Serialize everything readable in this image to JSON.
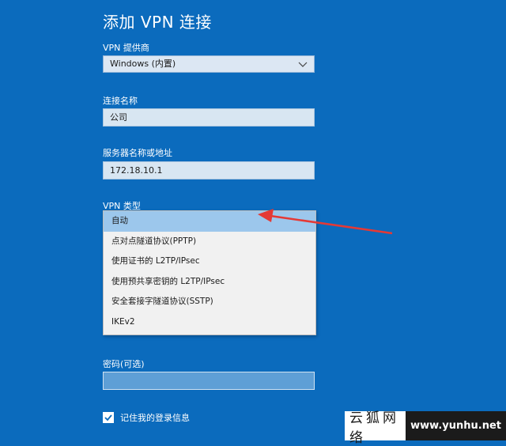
{
  "page": {
    "title": "添加 VPN 连接"
  },
  "provider": {
    "label": "VPN 提供商",
    "value": "Windows (内置)"
  },
  "connection_name": {
    "label": "连接名称",
    "value": "公司"
  },
  "server": {
    "label": "服务器名称或地址",
    "value": "172.18.10.1"
  },
  "vpn_type": {
    "label": "VPN 类型",
    "selected": "自动",
    "options": [
      "自动",
      "点对点隧道协议(PPTP)",
      "使用证书的 L2TP/IPsec",
      "使用预共享密钥的 L2TP/IPsec",
      "安全套接字隧道协议(SSTP)",
      "IKEv2"
    ]
  },
  "password": {
    "label": "密码(可选)",
    "value": ""
  },
  "remember": {
    "label": "记住我的登录信息",
    "checked": true
  },
  "annotation": {
    "color": "#e53935"
  },
  "watermark": {
    "cn": "云狐网络",
    "url": "www.yunhu.net"
  }
}
